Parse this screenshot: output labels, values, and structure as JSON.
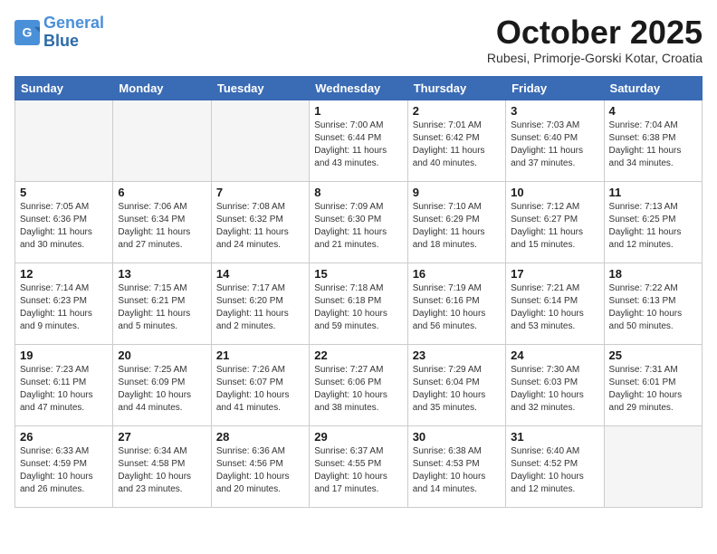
{
  "logo": {
    "line1": "General",
    "line2": "Blue"
  },
  "title": "October 2025",
  "subtitle": "Rubesi, Primorje-Gorski Kotar, Croatia",
  "weekdays": [
    "Sunday",
    "Monday",
    "Tuesday",
    "Wednesday",
    "Thursday",
    "Friday",
    "Saturday"
  ],
  "weeks": [
    [
      {
        "day": "",
        "info": ""
      },
      {
        "day": "",
        "info": ""
      },
      {
        "day": "",
        "info": ""
      },
      {
        "day": "1",
        "info": "Sunrise: 7:00 AM\nSunset: 6:44 PM\nDaylight: 11 hours\nand 43 minutes."
      },
      {
        "day": "2",
        "info": "Sunrise: 7:01 AM\nSunset: 6:42 PM\nDaylight: 11 hours\nand 40 minutes."
      },
      {
        "day": "3",
        "info": "Sunrise: 7:03 AM\nSunset: 6:40 PM\nDaylight: 11 hours\nand 37 minutes."
      },
      {
        "day": "4",
        "info": "Sunrise: 7:04 AM\nSunset: 6:38 PM\nDaylight: 11 hours\nand 34 minutes."
      }
    ],
    [
      {
        "day": "5",
        "info": "Sunrise: 7:05 AM\nSunset: 6:36 PM\nDaylight: 11 hours\nand 30 minutes."
      },
      {
        "day": "6",
        "info": "Sunrise: 7:06 AM\nSunset: 6:34 PM\nDaylight: 11 hours\nand 27 minutes."
      },
      {
        "day": "7",
        "info": "Sunrise: 7:08 AM\nSunset: 6:32 PM\nDaylight: 11 hours\nand 24 minutes."
      },
      {
        "day": "8",
        "info": "Sunrise: 7:09 AM\nSunset: 6:30 PM\nDaylight: 11 hours\nand 21 minutes."
      },
      {
        "day": "9",
        "info": "Sunrise: 7:10 AM\nSunset: 6:29 PM\nDaylight: 11 hours\nand 18 minutes."
      },
      {
        "day": "10",
        "info": "Sunrise: 7:12 AM\nSunset: 6:27 PM\nDaylight: 11 hours\nand 15 minutes."
      },
      {
        "day": "11",
        "info": "Sunrise: 7:13 AM\nSunset: 6:25 PM\nDaylight: 11 hours\nand 12 minutes."
      }
    ],
    [
      {
        "day": "12",
        "info": "Sunrise: 7:14 AM\nSunset: 6:23 PM\nDaylight: 11 hours\nand 9 minutes."
      },
      {
        "day": "13",
        "info": "Sunrise: 7:15 AM\nSunset: 6:21 PM\nDaylight: 11 hours\nand 5 minutes."
      },
      {
        "day": "14",
        "info": "Sunrise: 7:17 AM\nSunset: 6:20 PM\nDaylight: 11 hours\nand 2 minutes."
      },
      {
        "day": "15",
        "info": "Sunrise: 7:18 AM\nSunset: 6:18 PM\nDaylight: 10 hours\nand 59 minutes."
      },
      {
        "day": "16",
        "info": "Sunrise: 7:19 AM\nSunset: 6:16 PM\nDaylight: 10 hours\nand 56 minutes."
      },
      {
        "day": "17",
        "info": "Sunrise: 7:21 AM\nSunset: 6:14 PM\nDaylight: 10 hours\nand 53 minutes."
      },
      {
        "day": "18",
        "info": "Sunrise: 7:22 AM\nSunset: 6:13 PM\nDaylight: 10 hours\nand 50 minutes."
      }
    ],
    [
      {
        "day": "19",
        "info": "Sunrise: 7:23 AM\nSunset: 6:11 PM\nDaylight: 10 hours\nand 47 minutes."
      },
      {
        "day": "20",
        "info": "Sunrise: 7:25 AM\nSunset: 6:09 PM\nDaylight: 10 hours\nand 44 minutes."
      },
      {
        "day": "21",
        "info": "Sunrise: 7:26 AM\nSunset: 6:07 PM\nDaylight: 10 hours\nand 41 minutes."
      },
      {
        "day": "22",
        "info": "Sunrise: 7:27 AM\nSunset: 6:06 PM\nDaylight: 10 hours\nand 38 minutes."
      },
      {
        "day": "23",
        "info": "Sunrise: 7:29 AM\nSunset: 6:04 PM\nDaylight: 10 hours\nand 35 minutes."
      },
      {
        "day": "24",
        "info": "Sunrise: 7:30 AM\nSunset: 6:03 PM\nDaylight: 10 hours\nand 32 minutes."
      },
      {
        "day": "25",
        "info": "Sunrise: 7:31 AM\nSunset: 6:01 PM\nDaylight: 10 hours\nand 29 minutes."
      }
    ],
    [
      {
        "day": "26",
        "info": "Sunrise: 6:33 AM\nSunset: 4:59 PM\nDaylight: 10 hours\nand 26 minutes."
      },
      {
        "day": "27",
        "info": "Sunrise: 6:34 AM\nSunset: 4:58 PM\nDaylight: 10 hours\nand 23 minutes."
      },
      {
        "day": "28",
        "info": "Sunrise: 6:36 AM\nSunset: 4:56 PM\nDaylight: 10 hours\nand 20 minutes."
      },
      {
        "day": "29",
        "info": "Sunrise: 6:37 AM\nSunset: 4:55 PM\nDaylight: 10 hours\nand 17 minutes."
      },
      {
        "day": "30",
        "info": "Sunrise: 6:38 AM\nSunset: 4:53 PM\nDaylight: 10 hours\nand 14 minutes."
      },
      {
        "day": "31",
        "info": "Sunrise: 6:40 AM\nSunset: 4:52 PM\nDaylight: 10 hours\nand 12 minutes."
      },
      {
        "day": "",
        "info": ""
      }
    ]
  ]
}
